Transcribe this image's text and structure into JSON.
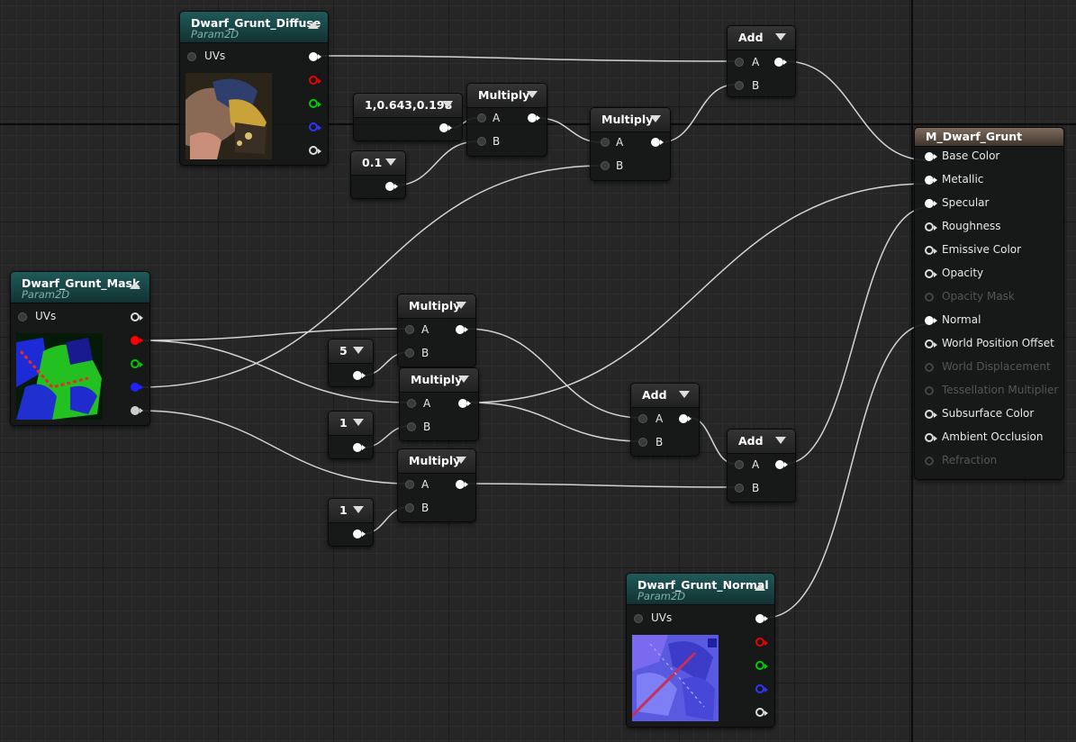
{
  "diffuse": {
    "title": "Dwarf_Grunt_Diffuse",
    "subtitle": "Param2D",
    "uvs_label": "UVs",
    "thumbnail_icon": "diffuse-texture-thumbnail"
  },
  "mask": {
    "title": "Dwarf_Grunt_Mask",
    "subtitle": "Param2D",
    "uvs_label": "UVs",
    "thumbnail_icon": "mask-texture-thumbnail"
  },
  "normal": {
    "title": "Dwarf_Grunt_Normal",
    "subtitle": "Param2D",
    "uvs_label": "UVs",
    "thumbnail_icon": "normal-texture-thumbnail"
  },
  "nodes": {
    "const_color": "1,0.643,0.198",
    "const_01": "0.1",
    "const_5": "5",
    "const_1a": "1",
    "const_1b": "1",
    "multiply_1": "Multiply",
    "multiply_2": "Multiply",
    "multiply_3": "Multiply",
    "multiply_4": "Multiply",
    "multiply_5": "Multiply",
    "add_top": "Add",
    "add_mid": "Add",
    "add_bottom": "Add",
    "pin_a": "A",
    "pin_b": "B"
  },
  "material": {
    "title": "M_Dwarf_Grunt",
    "pins": [
      {
        "label": "Base Color",
        "state": "connected"
      },
      {
        "label": "Metallic",
        "state": "connected"
      },
      {
        "label": "Specular",
        "state": "connected"
      },
      {
        "label": "Roughness",
        "state": "open"
      },
      {
        "label": "Emissive Color",
        "state": "open"
      },
      {
        "label": "Opacity",
        "state": "open"
      },
      {
        "label": "Opacity Mask",
        "state": "disabled"
      },
      {
        "label": "Normal",
        "state": "connected"
      },
      {
        "label": "World Position Offset",
        "state": "open"
      },
      {
        "label": "World Displacement",
        "state": "disabled"
      },
      {
        "label": "Tessellation Multiplier",
        "state": "disabled"
      },
      {
        "label": "Subsurface Color",
        "state": "open"
      },
      {
        "label": "Ambient Occlusion",
        "state": "open"
      },
      {
        "label": "Refraction",
        "state": "disabled"
      }
    ]
  },
  "colors": {
    "wire": "#e6e6e6",
    "param_header": "#1f5a59",
    "result_header": "#7d6b5c",
    "grid": "#262626"
  }
}
